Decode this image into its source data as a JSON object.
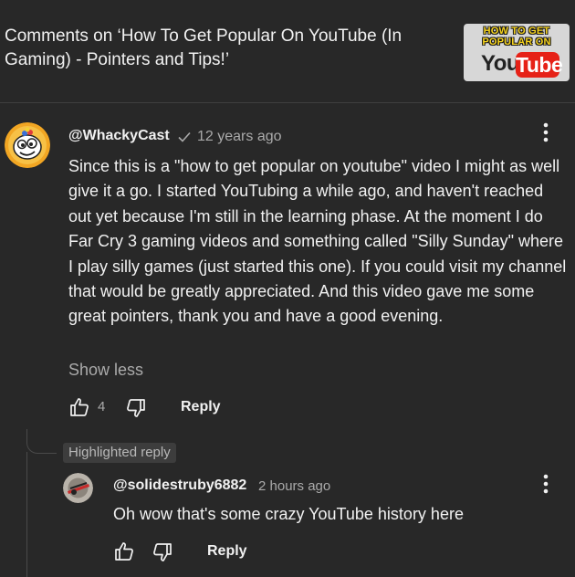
{
  "header": {
    "title": "Comments on ‘How To Get Popular On YouTube (In Gaming) - Pointers and Tips!’",
    "thumbnail": {
      "line1": "HOW TO GET",
      "line2": "POPULAR ON",
      "logo_you": "You",
      "logo_tube": "Tube"
    }
  },
  "comment": {
    "author": "@WhackyCast",
    "verified_icon": "check-icon",
    "time": "12 years ago",
    "text": "Since this is a \"how to get popular on youtube\" video I might as well give it a go. I started YouTubing a while ago, and haven't reached out yet because I'm still in the learning phase. At the moment I do Far Cry 3 gaming videos and something called \"Silly Sunday\" where I play silly games (just started this one). If you could visit my channel that would be greatly appreciated. And this video gave me some great pointers, thank you and have a good evening.",
    "show_less": "Show less",
    "likes": "4",
    "reply_label": "Reply"
  },
  "highlighted_label": "Highlighted reply",
  "reply": {
    "author": "@solidestruby6882",
    "time": "2 hours ago",
    "text": "Oh wow that's some crazy YouTube history here",
    "reply_label": "Reply"
  },
  "colors": {
    "background": "#282828",
    "secondary_text": "#aaaaaa",
    "badge_bg": "#3d3d3d",
    "youtube_red": "#e62117"
  }
}
